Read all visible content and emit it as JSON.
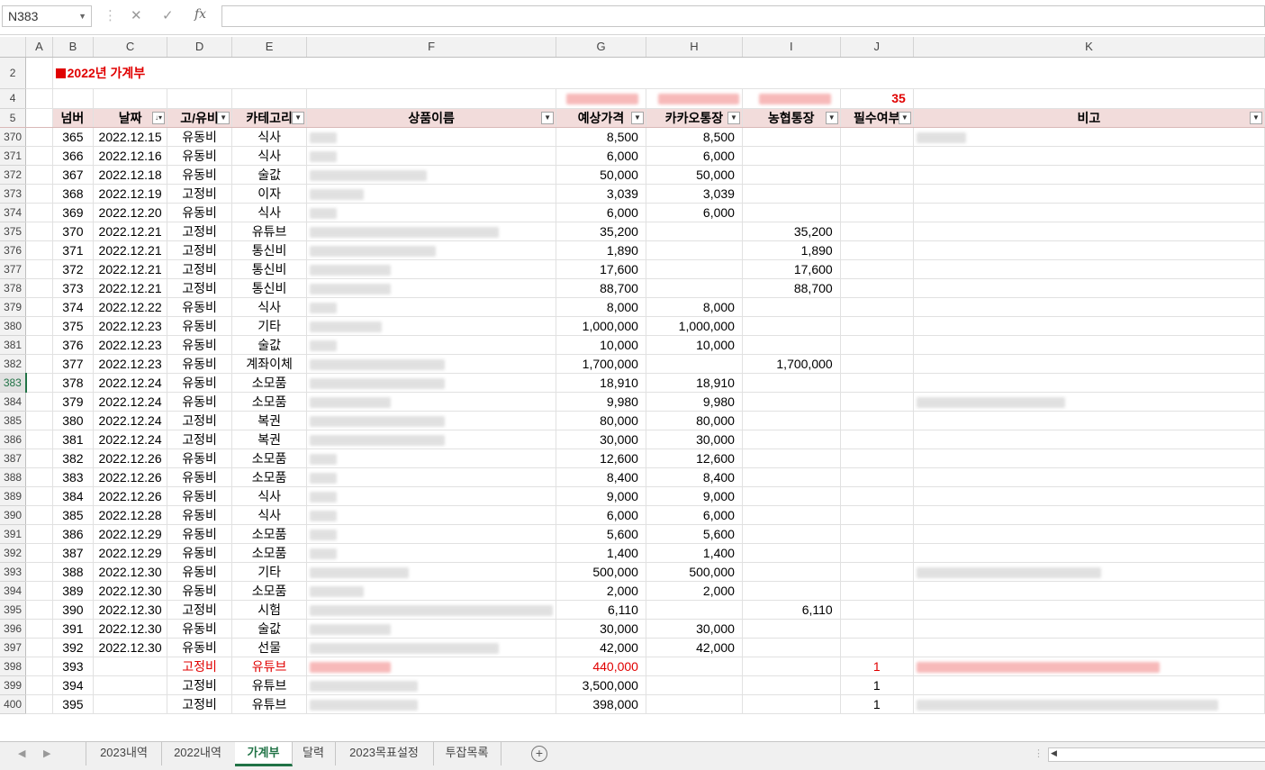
{
  "formula_bar": {
    "name_box": "N383",
    "cancel_icon": "✕",
    "enter_icon": "✓",
    "fx_label": "fx"
  },
  "columns": [
    "",
    "A",
    "B",
    "C",
    "D",
    "E",
    "F",
    "G",
    "H",
    "I",
    "J",
    "K"
  ],
  "sheet_title": "2022년 가계부",
  "row4_count": "35",
  "headers": [
    "넘버",
    "날짜",
    "고/유비",
    "카테고리",
    "상품이름",
    "예상가격",
    "카카오통장",
    "농협통장",
    "필수여부",
    "비고"
  ],
  "row_headers": {
    "title_row": "2",
    "count_row": "4",
    "header_row": "5"
  },
  "rows": [
    {
      "r": "370",
      "num": "365",
      "date": "2022.12.15",
      "type": "유동비",
      "cat": "식사",
      "price": "8,500",
      "kakao": "8,500",
      "nh": "",
      "req": ""
    },
    {
      "r": "371",
      "num": "366",
      "date": "2022.12.16",
      "type": "유동비",
      "cat": "식사",
      "price": "6,000",
      "kakao": "6,000",
      "nh": "",
      "req": ""
    },
    {
      "r": "372",
      "num": "367",
      "date": "2022.12.18",
      "type": "유동비",
      "cat": "술값",
      "price": "50,000",
      "kakao": "50,000",
      "nh": "",
      "req": ""
    },
    {
      "r": "373",
      "num": "368",
      "date": "2022.12.19",
      "type": "고정비",
      "cat": "이자",
      "price": "3,039",
      "kakao": "3,039",
      "nh": "",
      "req": ""
    },
    {
      "r": "374",
      "num": "369",
      "date": "2022.12.20",
      "type": "유동비",
      "cat": "식사",
      "price": "6,000",
      "kakao": "6,000",
      "nh": "",
      "req": ""
    },
    {
      "r": "375",
      "num": "370",
      "date": "2022.12.21",
      "type": "고정비",
      "cat": "유튜브",
      "price": "35,200",
      "kakao": "",
      "nh": "35,200",
      "req": ""
    },
    {
      "r": "376",
      "num": "371",
      "date": "2022.12.21",
      "type": "고정비",
      "cat": "통신비",
      "price": "1,890",
      "kakao": "",
      "nh": "1,890",
      "req": ""
    },
    {
      "r": "377",
      "num": "372",
      "date": "2022.12.21",
      "type": "고정비",
      "cat": "통신비",
      "price": "17,600",
      "kakao": "",
      "nh": "17,600",
      "req": ""
    },
    {
      "r": "378",
      "num": "373",
      "date": "2022.12.21",
      "type": "고정비",
      "cat": "통신비",
      "price": "88,700",
      "kakao": "",
      "nh": "88,700",
      "req": ""
    },
    {
      "r": "379",
      "num": "374",
      "date": "2022.12.22",
      "type": "유동비",
      "cat": "식사",
      "price": "8,000",
      "kakao": "8,000",
      "nh": "",
      "req": ""
    },
    {
      "r": "380",
      "num": "375",
      "date": "2022.12.23",
      "type": "유동비",
      "cat": "기타",
      "price": "1,000,000",
      "kakao": "1,000,000",
      "nh": "",
      "req": ""
    },
    {
      "r": "381",
      "num": "376",
      "date": "2022.12.23",
      "type": "유동비",
      "cat": "술값",
      "price": "10,000",
      "kakao": "10,000",
      "nh": "",
      "req": ""
    },
    {
      "r": "382",
      "num": "377",
      "date": "2022.12.23",
      "type": "유동비",
      "cat": "계좌이체",
      "price": "1,700,000",
      "kakao": "",
      "nh": "1,700,000",
      "req": ""
    },
    {
      "r": "383",
      "num": "378",
      "date": "2022.12.24",
      "type": "유동비",
      "cat": "소모품",
      "price": "18,910",
      "kakao": "18,910",
      "nh": "",
      "req": ""
    },
    {
      "r": "384",
      "num": "379",
      "date": "2022.12.24",
      "type": "유동비",
      "cat": "소모품",
      "price": "9,980",
      "kakao": "9,980",
      "nh": "",
      "req": ""
    },
    {
      "r": "385",
      "num": "380",
      "date": "2022.12.24",
      "type": "고정비",
      "cat": "복권",
      "price": "80,000",
      "kakao": "80,000",
      "nh": "",
      "req": ""
    },
    {
      "r": "386",
      "num": "381",
      "date": "2022.12.24",
      "type": "고정비",
      "cat": "복권",
      "price": "30,000",
      "kakao": "30,000",
      "nh": "",
      "req": ""
    },
    {
      "r": "387",
      "num": "382",
      "date": "2022.12.26",
      "type": "유동비",
      "cat": "소모품",
      "price": "12,600",
      "kakao": "12,600",
      "nh": "",
      "req": ""
    },
    {
      "r": "388",
      "num": "383",
      "date": "2022.12.26",
      "type": "유동비",
      "cat": "소모품",
      "price": "8,400",
      "kakao": "8,400",
      "nh": "",
      "req": ""
    },
    {
      "r": "389",
      "num": "384",
      "date": "2022.12.26",
      "type": "유동비",
      "cat": "식사",
      "price": "9,000",
      "kakao": "9,000",
      "nh": "",
      "req": ""
    },
    {
      "r": "390",
      "num": "385",
      "date": "2022.12.28",
      "type": "유동비",
      "cat": "식사",
      "price": "6,000",
      "kakao": "6,000",
      "nh": "",
      "req": ""
    },
    {
      "r": "391",
      "num": "386",
      "date": "2022.12.29",
      "type": "유동비",
      "cat": "소모품",
      "price": "5,600",
      "kakao": "5,600",
      "nh": "",
      "req": ""
    },
    {
      "r": "392",
      "num": "387",
      "date": "2022.12.29",
      "type": "유동비",
      "cat": "소모품",
      "price": "1,400",
      "kakao": "1,400",
      "nh": "",
      "req": ""
    },
    {
      "r": "393",
      "num": "388",
      "date": "2022.12.30",
      "type": "유동비",
      "cat": "기타",
      "price": "500,000",
      "kakao": "500,000",
      "nh": "",
      "req": ""
    },
    {
      "r": "394",
      "num": "389",
      "date": "2022.12.30",
      "type": "유동비",
      "cat": "소모품",
      "price": "2,000",
      "kakao": "2,000",
      "nh": "",
      "req": ""
    },
    {
      "r": "395",
      "num": "390",
      "date": "2022.12.30",
      "type": "고정비",
      "cat": "시험",
      "price": "6,110",
      "kakao": "",
      "nh": "6,110",
      "req": ""
    },
    {
      "r": "396",
      "num": "391",
      "date": "2022.12.30",
      "type": "유동비",
      "cat": "술값",
      "price": "30,000",
      "kakao": "30,000",
      "nh": "",
      "req": ""
    },
    {
      "r": "397",
      "num": "392",
      "date": "2022.12.30",
      "type": "유동비",
      "cat": "선물",
      "price": "42,000",
      "kakao": "42,000",
      "nh": "",
      "req": ""
    },
    {
      "r": "398",
      "num": "393",
      "date": "",
      "type": "고정비",
      "cat": "유튜브",
      "price": "440,000",
      "kakao": "",
      "nh": "",
      "req": "1",
      "red": true
    },
    {
      "r": "399",
      "num": "394",
      "date": "",
      "type": "고정비",
      "cat": "유튜브",
      "price": "3,500,000",
      "kakao": "",
      "nh": "",
      "req": "1"
    },
    {
      "r": "400",
      "num": "395",
      "date": "",
      "type": "고정비",
      "cat": "유튜브",
      "price": "398,000",
      "kakao": "",
      "nh": "",
      "req": "1"
    }
  ],
  "selected_row": "383",
  "sheet_tabs": [
    "2023내역",
    "2022내역",
    "가계부",
    "달력",
    "2023목표설정",
    "투잡목록"
  ],
  "active_tab": "가계부",
  "colors": {
    "accent_green": "#217346",
    "title_red": "#e00000",
    "header_pink": "#f2dcdb"
  }
}
